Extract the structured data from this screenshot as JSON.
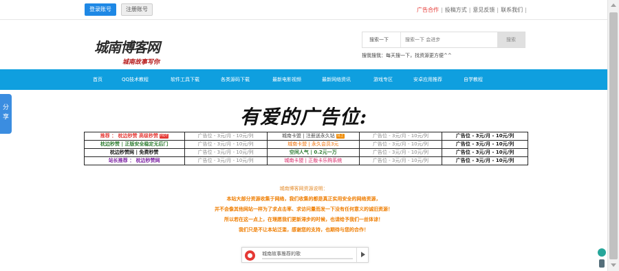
{
  "topbar": {
    "login_label": "登录账号",
    "register_label": "注册账号",
    "links": [
      "广告合作",
      "投稿方式",
      "意见反馈",
      "联系我们"
    ]
  },
  "logo": {
    "main": "城南博客网",
    "sub": "城南故事写你"
  },
  "search": {
    "category": "搜索一下",
    "placeholder": "搜索一下 会进步",
    "button": "搜索",
    "tip": "搜我搜我：每天搜一下，找资源更方便^^"
  },
  "nav": {
    "items": [
      "首页",
      "QQ技术教程",
      "软件工具下载",
      "各类源码下载",
      "最新电影视频",
      "最新网络资讯",
      "游戏专区",
      "安卓应用推荐",
      "自学教程"
    ]
  },
  "share": {
    "label": "分享"
  },
  "ads": {
    "title": "有爱的广告位:",
    "rows": [
      {
        "c1": "推荐 ： 枕边秒赞 高级秒赞",
        "c1_tag": "HOT",
        "c2": "广告位 - 3元/月 - 10元/列",
        "c3": "城南卡盟 | 注册送永久钻",
        "c3_tag": "马上",
        "c4": "广告位 - 3元/月 - 10元/列",
        "c5": "广告位 - 3元/月 - 10元/列"
      },
      {
        "c1": "枕边秒赞 | 正版安全稳定无后门",
        "c2": "广告位 - 3元/月 - 10元/列",
        "c3": "城南卡盟 | 永久会员3元",
        "c4": "广告位 - 3元/月 - 10元/列",
        "c5": "广告位 - 3元/月 - 10元/列"
      },
      {
        "c1": "枕边秒赞网 | 免费秒赞",
        "c2": "广告位 - 3元/月 - 10元/列",
        "c3": "空间人气 | 0.2元一万",
        "c4": "广告位 - 3元/月 - 10元/列",
        "c5": "广告位 - 3元/月 - 10元/列"
      },
      {
        "c1": "站长推荐 ： 枕边秒赞网",
        "c2": "广告位 - 3元/月 - 10元/列",
        "c3": "城南卡盟 | 正版卡乐购系统",
        "c4": "广告位 - 3元/月 - 10元/列",
        "c5": "广告位 - 3元/月 - 10元/列"
      }
    ]
  },
  "notice": {
    "title": "城南博客网资源说明：",
    "lines": [
      "本站大部分资源收集于网络，我们收集的都是真正实用安全的网络资源，",
      "并不会像其他网站一样为了求点击率、求访问量而发一下没有任何意义的诚旧资源！",
      "所以若在这一点上，在理愿我们更新滞步的时候，也请给予我们一丝体谅！",
      "我们只是不让本站泛滥，感谢您的支持，也期待与您的合作！"
    ]
  },
  "player": {
    "title": "城南故事推荐的歌"
  }
}
